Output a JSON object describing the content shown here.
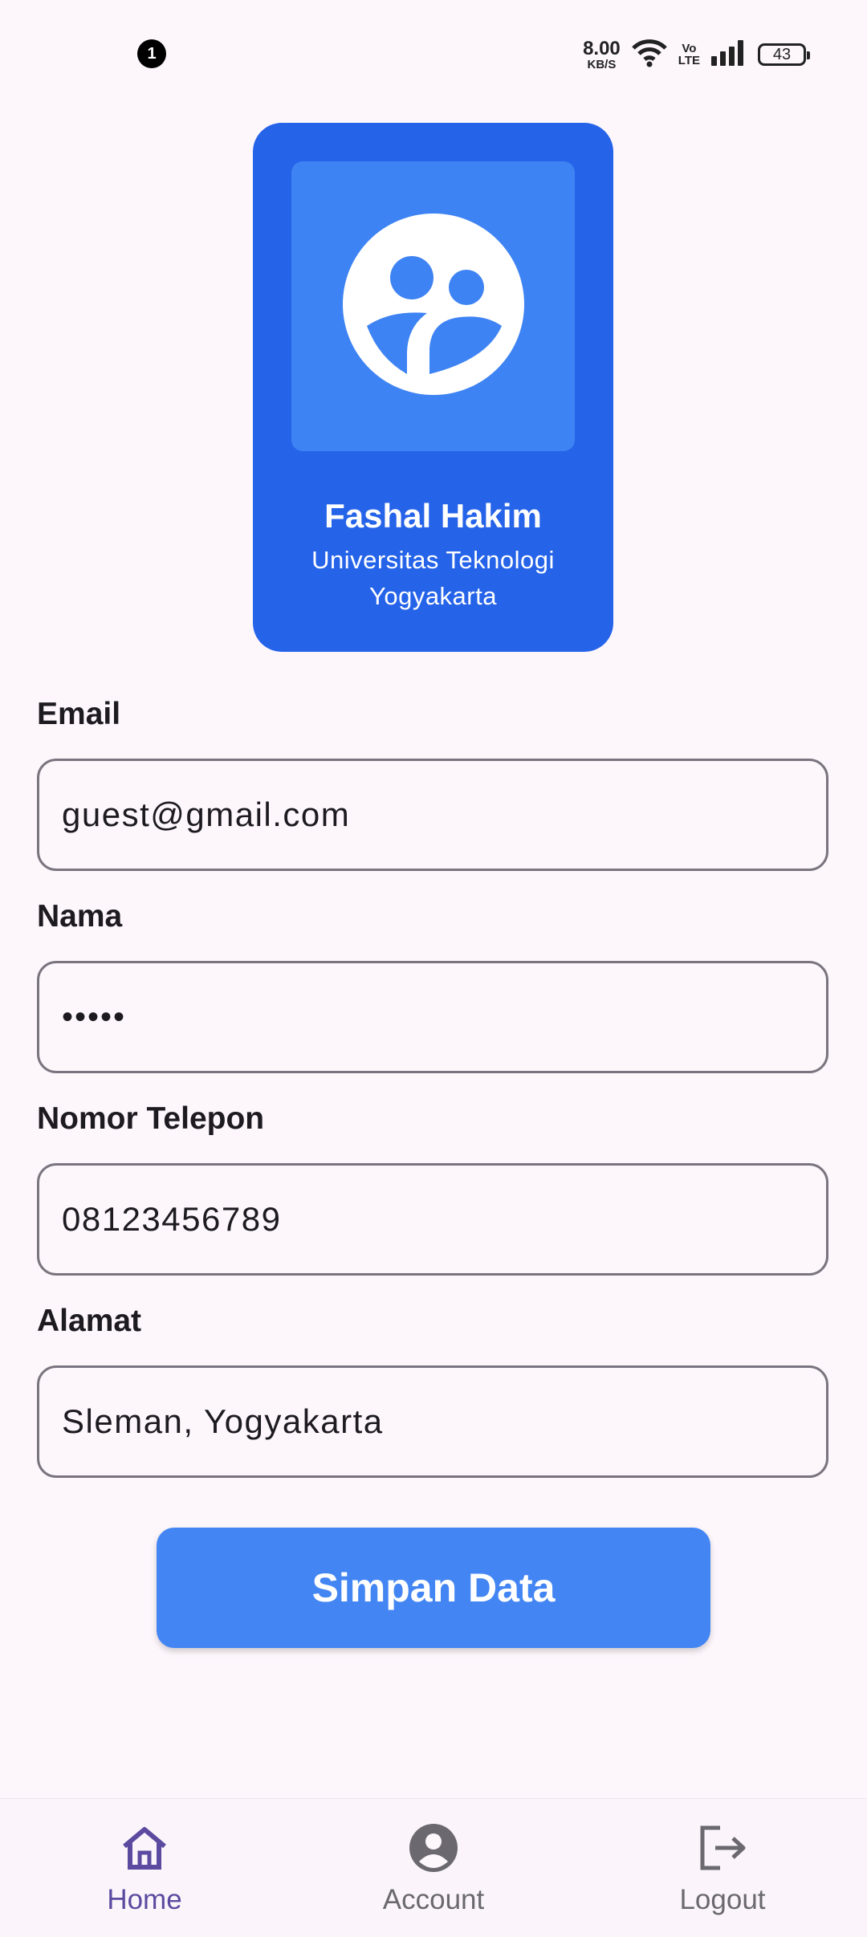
{
  "status_bar": {
    "notification_count": "1",
    "net_speed_value": "8.00",
    "net_speed_unit": "KB/S",
    "volte_top": "Vo",
    "volte_bottom": "LTE",
    "battery_level": "43"
  },
  "profile": {
    "avatar_icon": "group-avatar-icon",
    "name": "Fashal Hakim",
    "university_line1": "Universitas Teknologi",
    "university_line2": "Yogyakarta"
  },
  "form": {
    "email_label": "Email",
    "email_value": "guest@gmail.com",
    "nama_label": "Nama",
    "nama_value": "•••••",
    "phone_label": "Nomor Telepon",
    "phone_value": "08123456789",
    "address_label": "Alamat",
    "address_value": "Sleman, Yogyakarta"
  },
  "save_button_label": "Simpan Data",
  "bottom_nav": {
    "items": [
      {
        "label": "Home",
        "icon": "home-icon",
        "active": true
      },
      {
        "label": "Account",
        "icon": "account-circle-icon",
        "active": false
      },
      {
        "label": "Logout",
        "icon": "logout-icon",
        "active": false
      }
    ]
  },
  "colors": {
    "card_bg": "#2563e9",
    "card_image_bg": "#3e83f3",
    "button_bg": "#4386f3",
    "active_nav": "#5b4aa0",
    "page_bg": "#fdf7fc"
  }
}
